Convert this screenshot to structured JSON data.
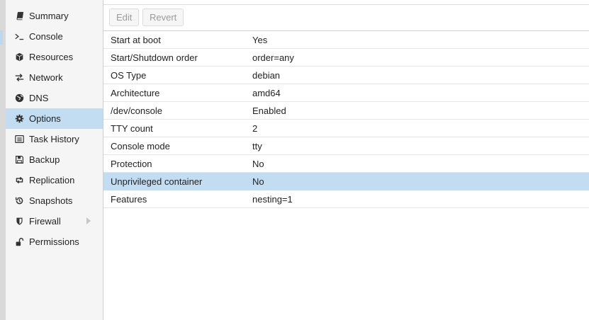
{
  "sidebar": {
    "items": [
      {
        "label": "Summary",
        "icon": "book-icon"
      },
      {
        "label": "Console",
        "icon": "terminal-icon"
      },
      {
        "label": "Resources",
        "icon": "cube-icon"
      },
      {
        "label": "Network",
        "icon": "exchange-icon"
      },
      {
        "label": "DNS",
        "icon": "globe-icon"
      },
      {
        "label": "Options",
        "icon": "gear-icon",
        "active": true
      },
      {
        "label": "Task History",
        "icon": "list-alt-icon"
      },
      {
        "label": "Backup",
        "icon": "floppy-icon"
      },
      {
        "label": "Replication",
        "icon": "retweet-icon"
      },
      {
        "label": "Snapshots",
        "icon": "history-icon"
      },
      {
        "label": "Firewall",
        "icon": "shield-icon",
        "expandable": true
      },
      {
        "label": "Permissions",
        "icon": "unlock-icon"
      }
    ]
  },
  "toolbar": {
    "edit_label": "Edit",
    "revert_label": "Revert"
  },
  "options": {
    "rows": [
      {
        "key": "Start at boot",
        "value": "Yes"
      },
      {
        "key": "Start/Shutdown order",
        "value": "order=any"
      },
      {
        "key": "OS Type",
        "value": "debian"
      },
      {
        "key": "Architecture",
        "value": "amd64"
      },
      {
        "key": "/dev/console",
        "value": "Enabled"
      },
      {
        "key": "TTY count",
        "value": "2"
      },
      {
        "key": "Console mode",
        "value": "tty"
      },
      {
        "key": "Protection",
        "value": "No"
      },
      {
        "key": "Unprivileged container",
        "value": "No",
        "selected": true
      },
      {
        "key": "Features",
        "value": "nesting=1"
      }
    ]
  },
  "colors": {
    "selection": "#c2ddf2",
    "sidebar_bg": "#f5f5f5",
    "disabled_text": "#9a9a9a"
  }
}
